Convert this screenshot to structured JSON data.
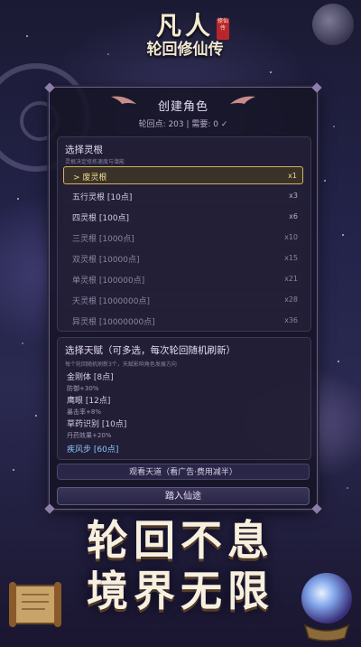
{
  "logo": {
    "main": "凡人",
    "sub": "轮回修仙传",
    "seal": "修仙传"
  },
  "panel": {
    "title": "创建角色",
    "subtitle": "轮回点: 203 | 需要: 0 ✓"
  },
  "root_section": {
    "title": "选择灵根",
    "hint": "灵根决定修炼速度与潜能",
    "options": [
      {
        "label": "> 废灵根",
        "mult": "x1",
        "selected": true
      },
      {
        "label": "五行灵根 [10点]",
        "mult": "x3"
      },
      {
        "label": "四灵根 [100点]",
        "mult": "x6"
      },
      {
        "label": "三灵根 [1000点]",
        "mult": "x10"
      },
      {
        "label": "双灵根 [10000点]",
        "mult": "x15"
      },
      {
        "label": "单灵根 [100000点]",
        "mult": "x21"
      },
      {
        "label": "天灵根 [1000000点]",
        "mult": "x28"
      },
      {
        "label": "异灵根 [10000000点]",
        "mult": "x36"
      }
    ]
  },
  "talent_section": {
    "title": "选择天赋（可多选，每次轮回随机刷新）",
    "hint": "每个轮回随机刷新3个，天赋影响角色发展方向",
    "talents": [
      {
        "name": "金刚体 [8点]",
        "desc": "防御+30%"
      },
      {
        "name": "鹰眼 [12点]",
        "desc": "暴击率+8%"
      },
      {
        "name": "草药识别 [10点]",
        "desc": "丹药效果+20%"
      },
      {
        "name": "疾风步 [60点]",
        "desc": ""
      }
    ]
  },
  "buttons": {
    "watch_ad": "观看天道（看广告·费用减半）",
    "enter": "踏入仙途"
  },
  "slogan": {
    "line1": "轮回不息",
    "line2": "境界无限"
  }
}
